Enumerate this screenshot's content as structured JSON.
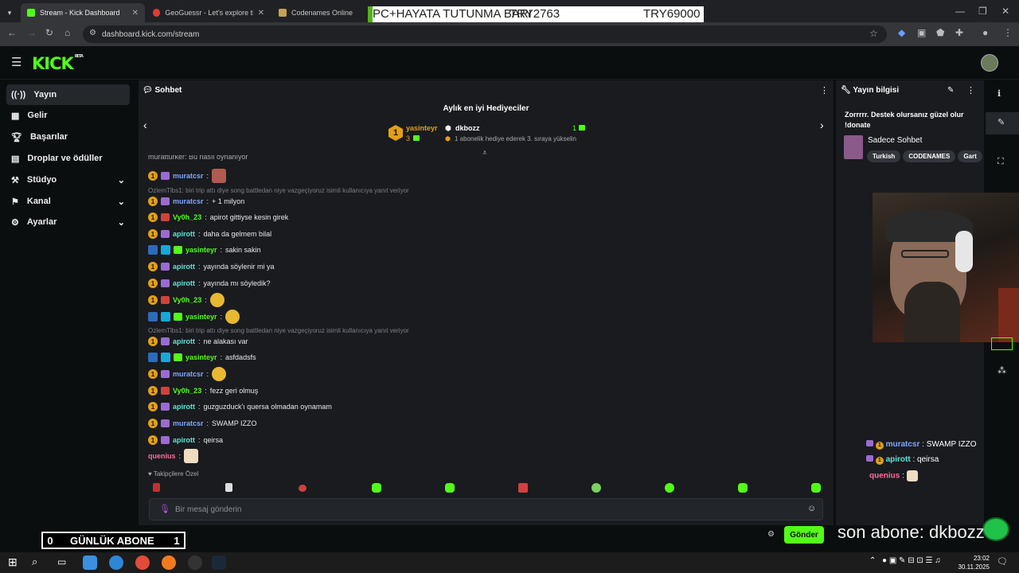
{
  "browser": {
    "tabs": [
      {
        "label": "Stream - Kick Dashboard"
      },
      {
        "label": "GeoGuessr - Let's explore the w"
      },
      {
        "label": "Codenames Online"
      }
    ],
    "url": "dashboard.kick.com/stream"
  },
  "overlay": {
    "bar_text": "PC+HAYATA TUTUNMA BARI",
    "bar_current": "TRY2763",
    "bar_goal": "TRY69000",
    "sonabone": "son abone: dkbozz",
    "gunluk_left": "0",
    "gunluk_label": "GÜNLÜK ABONE",
    "gunluk_right": "1"
  },
  "kick": {
    "logo": "KICK",
    "logo_sup": "BETA"
  },
  "sidebar": {
    "items": [
      {
        "label": "Yayın",
        "icon": "broadcast-icon"
      },
      {
        "label": "Gelir",
        "icon": "revenue-icon"
      },
      {
        "label": "Başarılar",
        "icon": "trophy-icon"
      },
      {
        "label": "Droplar ve ödüller",
        "icon": "drops-icon"
      },
      {
        "label": "Stüdyo",
        "icon": "studio-icon"
      },
      {
        "label": "Kanal",
        "icon": "channel-icon"
      },
      {
        "label": "Ayarlar",
        "icon": "settings-icon"
      }
    ]
  },
  "chat": {
    "title": "Sohbet",
    "gift_title": "Aylık en iyi Hediyeciler",
    "gifter1_name": "yasinteyr",
    "gifter1_count": "3",
    "gifter2_name": "dkbozz",
    "gifter2_count": "1",
    "gifter2_note": "1 abonelik hediye ederek 3. sıraya yükselin",
    "top_cut": "muratturker: Bu nasıl oynanıyor",
    "messages": [
      {
        "user": "muratcsr",
        "text": "",
        "color": "#7ea8ff"
      },
      {
        "reply": "OzlemTlbs1: biri trip attı diye song battledan niye vazgeçiyoruz isimli kullanıcıya yanıt veriyor"
      },
      {
        "user": "muratcsr",
        "text": "+ 1 milyon",
        "color": "#7ea8ff"
      },
      {
        "user": "Vy0h_23",
        "text": "apirot gittiyse kesin girek",
        "color": "#53fc18"
      },
      {
        "user": "apirott",
        "text": "daha da gelmem bilal",
        "color": "#5fe3d3"
      },
      {
        "user": "yasinteyr",
        "text": "sakin sakin",
        "color": "#53fc18"
      },
      {
        "user": "apirott",
        "text": "yayında söylenir mi ya",
        "color": "#5fe3d3"
      },
      {
        "user": "apirott",
        "text": "yayında mı söyledik?",
        "color": "#5fe3d3"
      },
      {
        "user": "Vy0h_23",
        "text": "",
        "color": "#53fc18"
      },
      {
        "user": "yasinteyr",
        "text": "",
        "color": "#53fc18"
      },
      {
        "reply": "OzlemTlbs1: biri trip attı diye song battledan niye vazgeçiyoruz isimli kullanıcıya yanıt veriyor"
      },
      {
        "user": "apirott",
        "text": "ne alakası var",
        "color": "#5fe3d3"
      },
      {
        "user": "yasinteyr",
        "text": "asfdadsfs",
        "color": "#53fc18"
      },
      {
        "user": "muratcsr",
        "text": "",
        "color": "#7ea8ff"
      },
      {
        "user": "Vy0h_23",
        "text": "fezz geri olmuş",
        "color": "#53fc18"
      },
      {
        "user": "apirott",
        "text": "guzguzduck'ı quersa olmadan oynamam",
        "color": "#5fe3d3"
      },
      {
        "user": "muratcsr",
        "text": "SWAMP IZZO",
        "color": "#7ea8ff"
      },
      {
        "user": "apirott",
        "text": "qeirsa",
        "color": "#5fe3d3"
      },
      {
        "user": "quenius",
        "text": "",
        "color": "#ff6b9a"
      }
    ],
    "followers_label": "Takipçilere Özel",
    "input_placeholder": "Bir mesaj gönderin",
    "send_label": "Gönder",
    "counter": "0"
  },
  "info": {
    "title": "Yayın bilgisi",
    "stream_title": "Zorrrrr. Destek olursanız güzel olur !donate",
    "category": "Sadece Sohbet",
    "tags": [
      "Turkish",
      "CODENAMES",
      "Gart"
    ]
  },
  "overlay_chat": [
    {
      "user": "muratcsr",
      "text": "SWAMP IZZO",
      "color": "#7ea8ff"
    },
    {
      "user": "apirott",
      "text": "qeirsa",
      "color": "#5fe3d3"
    },
    {
      "user": "quenius",
      "text": "",
      "color": "#ff6b9a"
    }
  ],
  "taskbar": {
    "time": "23:02",
    "date": "30.11.2025"
  },
  "colors": {
    "accent": "#53fc18"
  }
}
